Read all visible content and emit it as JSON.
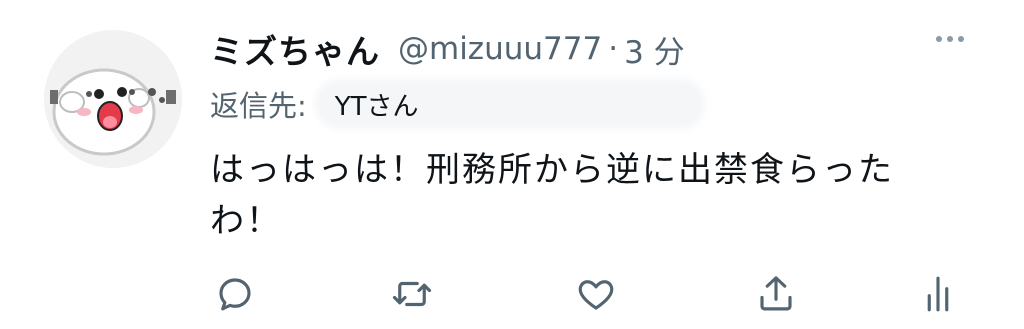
{
  "tweet": {
    "display_name": "ミズちゃん",
    "handle": "@mizuuu777",
    "separator": "·",
    "time": "3 分",
    "reply_label": "返信先:",
    "reply_to": "YTさん",
    "text": "はっはっは！刑務所から逆に出禁食らったわ！"
  },
  "icons": {
    "more": "more-dots-icon",
    "reply": "speech-bubble-icon",
    "retweet": "retweet-icon",
    "like": "heart-icon",
    "share": "share-icon",
    "views": "bar-chart-icon"
  },
  "colors": {
    "text": "#0f1419",
    "secondary": "#536471",
    "icon": "#536471"
  }
}
